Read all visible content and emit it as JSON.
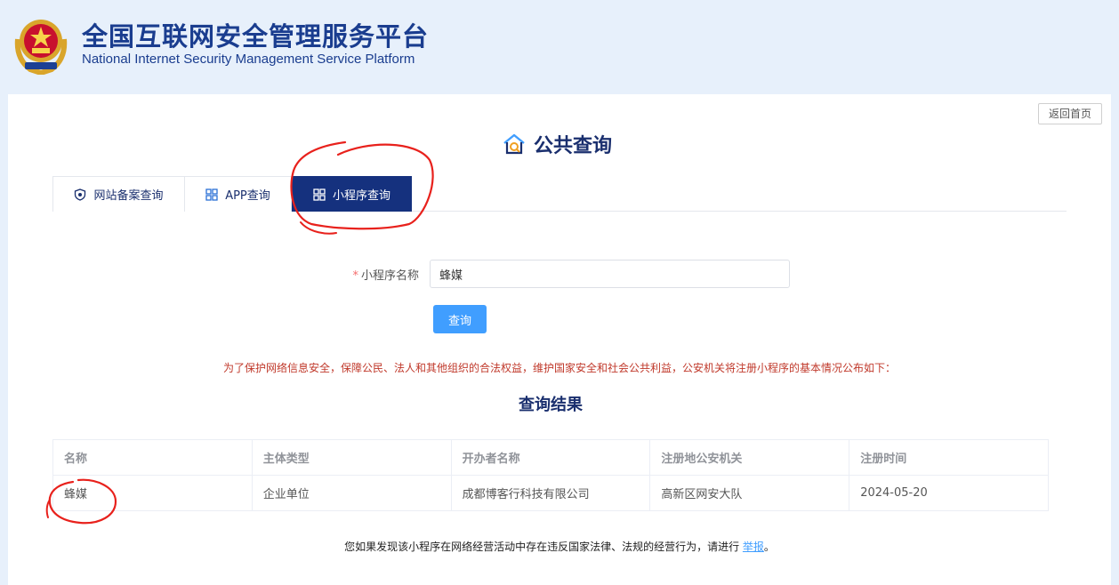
{
  "header": {
    "title_cn": "全国互联网安全管理服务平台",
    "title_en": "National Internet Security Management Service Platform"
  },
  "toolbar": {
    "back_home_label": "返回首页"
  },
  "page": {
    "heading": "公共查询"
  },
  "tabs": [
    {
      "label": "网站备案查询",
      "icon": "shield-icon",
      "active": false
    },
    {
      "label": "APP查询",
      "icon": "grid-icon",
      "active": false
    },
    {
      "label": "小程序查询",
      "icon": "grid-icon",
      "active": true
    }
  ],
  "form": {
    "required_mark": "*",
    "label": "小程序名称",
    "value": "蜂媒",
    "submit_label": "查询"
  },
  "notice": "为了保护网络信息安全，保障公民、法人和其他组织的合法权益，维护国家安全和社会公共利益，公安机关将注册小程序的基本情况公布如下：",
  "results": {
    "title": "查询结果",
    "columns": [
      "名称",
      "主体类型",
      "开办者名称",
      "注册地公安机关",
      "注册时间"
    ],
    "rows": [
      [
        "蜂媒",
        "企业单位",
        "成都博客行科技有限公司",
        "高新区网安大队",
        "2024-05-20"
      ]
    ]
  },
  "footer": {
    "text": "您如果发现该小程序在网络经营活动中存在违反国家法律、法规的经营行为，请进行",
    "link_label": "举报",
    "suffix": "。"
  },
  "colors": {
    "brand_navy": "#15317e",
    "title_blue": "#1a3d8f",
    "primary_button": "#409eff",
    "notice_red": "#c0392b",
    "annotation_red": "#e8211c",
    "page_background": "#e7f0fb"
  }
}
